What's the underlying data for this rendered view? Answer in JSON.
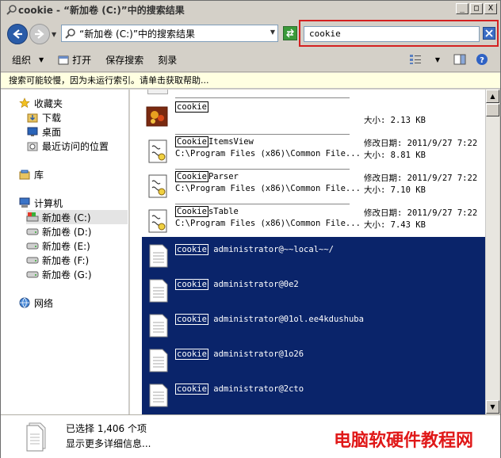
{
  "window": {
    "title": "cookie - “新加卷 (C:)”中的搜索结果",
    "btn_min": "_",
    "btn_max": "□",
    "btn_close": "X"
  },
  "address": {
    "path": "“新加卷 (C:)”中的搜索结果",
    "search_value": "cookie"
  },
  "toolbar": {
    "organize": "组织",
    "open": "打开",
    "save_search": "保存搜索",
    "burn": "刻录"
  },
  "infobar": {
    "text": "搜索可能较慢，因为未运行索引。请单击获取帮助..."
  },
  "nav": {
    "favorites": "收藏夹",
    "downloads": "下载",
    "desktop": "桌面",
    "recent": "最近访问的位置",
    "libraries": "库",
    "computer": "计算机",
    "drives": [
      "新加卷 (C:)",
      "新加卷 (D:)",
      "新加卷 (E:)",
      "新加卷 (F:)",
      "新加卷 (G:)"
    ],
    "network": "网络"
  },
  "files": [
    {
      "hl": "cookie",
      "rest": "",
      "path": "",
      "meta1": "",
      "meta2": "大小: 2.13 KB"
    },
    {
      "hl": "Cookie",
      "rest": "ItemsView",
      "path": "C:\\Program Files (x86)\\Common File...",
      "meta1": "修改日期: 2011/9/27 7:22",
      "meta2": "大小: 8.81 KB"
    },
    {
      "hl": "Cookie",
      "rest": "Parser",
      "path": "C:\\Program Files (x86)\\Common File...",
      "meta1": "修改日期: 2011/9/27 7:22",
      "meta2": "大小: 7.10 KB"
    },
    {
      "hl": "Cookie",
      "rest": "sTable",
      "path": "C:\\Program Files (x86)\\Common File...",
      "meta1": "修改日期: 2011/9/27 7:22",
      "meta2": "大小: 7.43 KB"
    }
  ],
  "selected_files": [
    {
      "hl": "cookie",
      "rest": "administrator@~~local~~/"
    },
    {
      "hl": "cookie",
      "rest": "administrator@0e2"
    },
    {
      "hl": "cookie",
      "rest": "administrator@01ol.ee4kdushuba"
    },
    {
      "hl": "cookie",
      "rest": "administrator@1o26"
    },
    {
      "hl": "cookie",
      "rest": "administrator@2cto"
    }
  ],
  "status": {
    "selected": "已选择 1,406 个项",
    "more_details": "显示更多详细信息..."
  },
  "watermark": "电脑软硬件教程网",
  "colors": {
    "selection": "#0a246a",
    "search_outline": "#d42020",
    "watermark": "#e01818"
  }
}
